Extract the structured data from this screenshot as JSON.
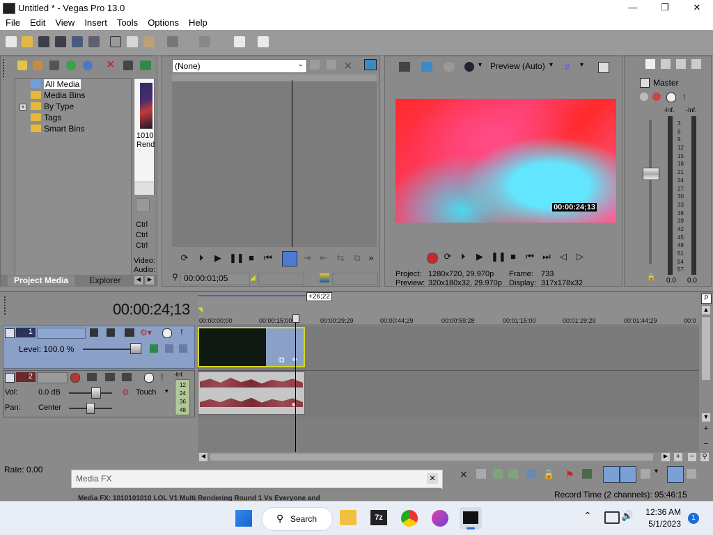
{
  "window": {
    "title": "Untitled * - Vegas Pro 13.0",
    "minimize": "—",
    "maximize": "❐",
    "close": "✕"
  },
  "menu": [
    "File",
    "Edit",
    "View",
    "Insert",
    "Tools",
    "Options",
    "Help"
  ],
  "project_media": {
    "tree": [
      {
        "label": "All Media",
        "selected": true
      },
      {
        "label": "Media Bins"
      },
      {
        "label": "By Type",
        "expander": "+"
      },
      {
        "label": "Tags"
      },
      {
        "label": "Smart Bins"
      }
    ],
    "thumb_caption_1": "1010",
    "thumb_caption_2": "Rend",
    "ctrl_lines": [
      "Ctrl",
      "Ctrl",
      "Ctrl"
    ],
    "video_label": "Video:",
    "audio_label": "Audio:",
    "tabs": [
      "Project Media",
      "Explorer"
    ]
  },
  "trimmer": {
    "dropdown_value": "(None)",
    "timecode": "00:00:01;05"
  },
  "preview": {
    "quality": "Preview (Auto)",
    "overlay_timecode": "00:00:24;13",
    "project_label": "Project:",
    "project_value": "1280x720, 29.970p",
    "preview_label": "Preview:",
    "preview_value": "320x180x32, 29.970p",
    "frame_label": "Frame:",
    "frame_value": "733",
    "display_label": "Display:",
    "display_value": "317x178x32"
  },
  "mixer": {
    "title": "Master",
    "inf_left": "-Inf.",
    "inf_right": "-Inf.",
    "scale": [
      "3",
      "6",
      "9",
      "12",
      "15",
      "18",
      "21",
      "24",
      "27",
      "30",
      "33",
      "36",
      "39",
      "42",
      "45",
      "48",
      "51",
      "54",
      "57"
    ],
    "bottom_left": "0.0",
    "bottom_right": "0.0"
  },
  "timeline": {
    "cursor_time": "00:00:24;13",
    "offset_badge": "+26;22",
    "ruler": [
      "00:00:00;00",
      "00:00:15;00",
      "00:00:29;29",
      "00:00:44;29",
      "00:00:59;28",
      "00:01:15;00",
      "00:01:29;29",
      "00:01:44;29",
      "00:0"
    ],
    "video_track": {
      "number": "1",
      "level": "Level: 100.0 %"
    },
    "audio_track": {
      "number": "2",
      "vol_label": "Vol:",
      "vol_value": "0.0 dB",
      "pan_label": "Pan:",
      "pan_value": "Center",
      "mode": "Touch",
      "meter_top": "-Inf.",
      "meter_scale": [
        "12",
        "24",
        "36",
        "48"
      ]
    }
  },
  "status": {
    "rate": "Rate: 0.00",
    "media_fx_title": "Media FX",
    "media_fx_text": "Media FX: 1010101010 LOL V1 Multi Rendering Round 1 Vs Everyone and",
    "record_time": "Record Time (2 channels): 95:46:15"
  },
  "taskbar": {
    "search": "Search",
    "time": "12:36 AM",
    "date": "5/1/2023",
    "notifications": "1",
    "archiver_label": "7z"
  }
}
